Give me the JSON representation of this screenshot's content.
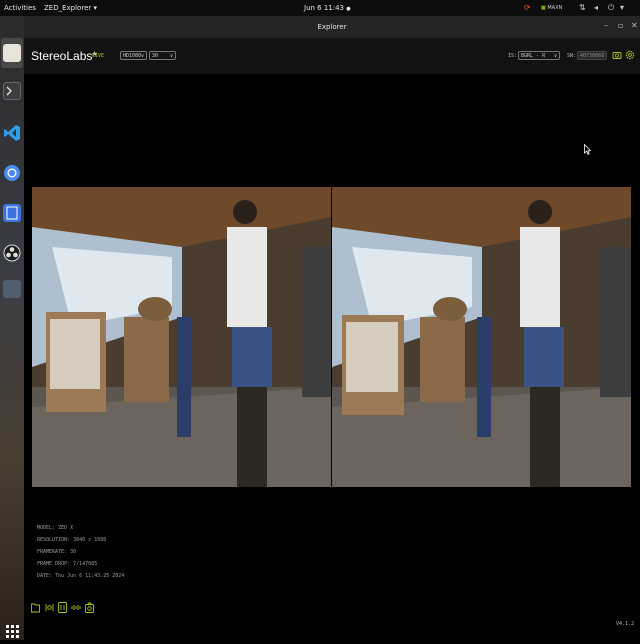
{
  "topbar": {
    "activities": "Activities",
    "app_menu": "ZED_Explorer",
    "app_menu_chevron": "▾",
    "clock": "Jun 6  11:43",
    "clock_dot": "●",
    "status_text": "MAXN"
  },
  "window": {
    "title": "Explorer",
    "minimize": "–",
    "maximize": "▫",
    "close": "✕"
  },
  "header": {
    "brand": "StereoLabs*",
    "live": "LIVE",
    "resolution": "HD1080",
    "fps": "30",
    "is_label": "IS:",
    "is_value": "BGRL - R",
    "sn_label": "SN:",
    "sn_value": "40730868"
  },
  "info": {
    "model": "MODEL: ZED X",
    "resolution": "RESOLUTION: 3840 x 1080",
    "framerate": "FRAMERATE: 30",
    "frame_drop": "FRAME DROP: 7/147085",
    "date": "DATE: Thu Jun 6 11:43.25 2024"
  },
  "version": "V4.1.2",
  "colors": {
    "accent": "#a8c41a",
    "topbar_bg": "#0d0d0d",
    "header_bg": "#121212",
    "titlebar_bg": "#242424"
  },
  "icons": {
    "dock": [
      "files-icon",
      "terminal-icon",
      "vscode-icon",
      "chromium-icon",
      "text-editor-icon",
      "obs-icon",
      "app-icon",
      "show-apps-icon"
    ],
    "bottom": [
      "folder-icon",
      "record-icon",
      "stream-icon",
      "svo-icon",
      "snapshot-icon"
    ]
  }
}
